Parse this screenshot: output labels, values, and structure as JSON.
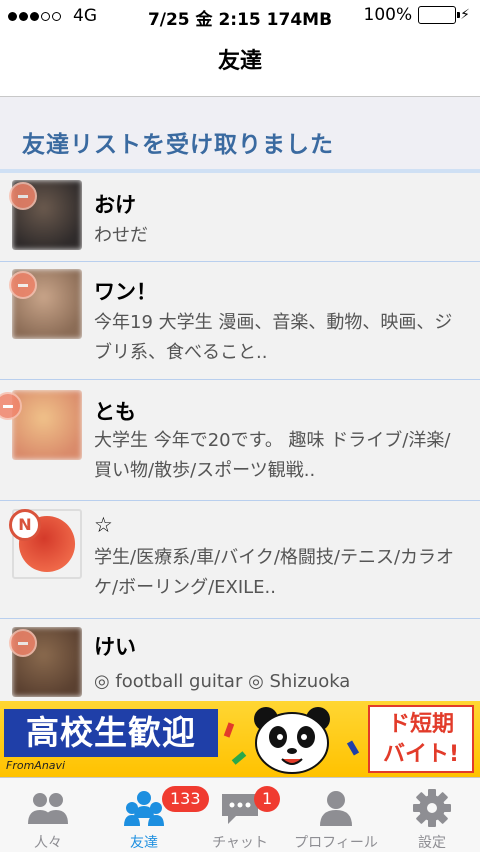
{
  "status_bar": {
    "carrier": "4G",
    "datetime": "7/25 金 2:15 174MB",
    "battery_percent": "100%",
    "signal_bars_filled": 3,
    "signal_bars_total": 5
  },
  "nav": {
    "title": "友達"
  },
  "section": {
    "title": "友達リストを受け取りました"
  },
  "friends": [
    {
      "name": "おけ",
      "description": "わせだ",
      "badge": "dot",
      "photo_colors": [
        "#6b5a4e",
        "#2e2a2a"
      ]
    },
    {
      "name": "ワン！",
      "description": "今年19 大学生 漫画、音楽、動物、映画、ジブリ系、食べること..",
      "badge": "dot",
      "photo_colors": [
        "#c9a58a",
        "#8a6b55"
      ]
    },
    {
      "name": "とも",
      "description": "大学生 今年で20です。 趣味 ドライブ/洋楽/買い物/散歩/スポーツ観戦..",
      "badge": "dot",
      "photo_colors": [
        "#f0c28a",
        "#d98a6a"
      ]
    },
    {
      "name": "☆",
      "description": "学生/医療系/車/バイク/格闘技/テニス/カラオケ/ボーリング/EXILE..",
      "badge": "N",
      "photo_colors": [
        "#d43a2a",
        "#f06a4a"
      ]
    },
    {
      "name": "けい",
      "description": "◎ football guitar ◎ Shizuoka",
      "badge": "dot",
      "photo_colors": [
        "#8a6a4e",
        "#5a4030"
      ]
    }
  ],
  "ad": {
    "left_text": "高校生歓迎",
    "right_text_line1": "ド短期",
    "right_text_line2": "バイト!",
    "logo": "FromAnavi"
  },
  "tabs": [
    {
      "label": "人々",
      "icon": "people-icon",
      "badge": "",
      "active": false
    },
    {
      "label": "友達",
      "icon": "friends-icon",
      "badge": "133",
      "active": true
    },
    {
      "label": "チャット",
      "icon": "chat-icon",
      "badge": "1",
      "active": false
    },
    {
      "label": "プロフィール",
      "icon": "profile-icon",
      "badge": "",
      "active": false
    },
    {
      "label": "設定",
      "icon": "gear-icon",
      "badge": "",
      "active": false
    }
  ],
  "colors": {
    "section_title": "#3a6aa0",
    "tab_active": "#1d8fe0",
    "tab_inactive": "#8e8e93",
    "badge": "#f03b30"
  }
}
